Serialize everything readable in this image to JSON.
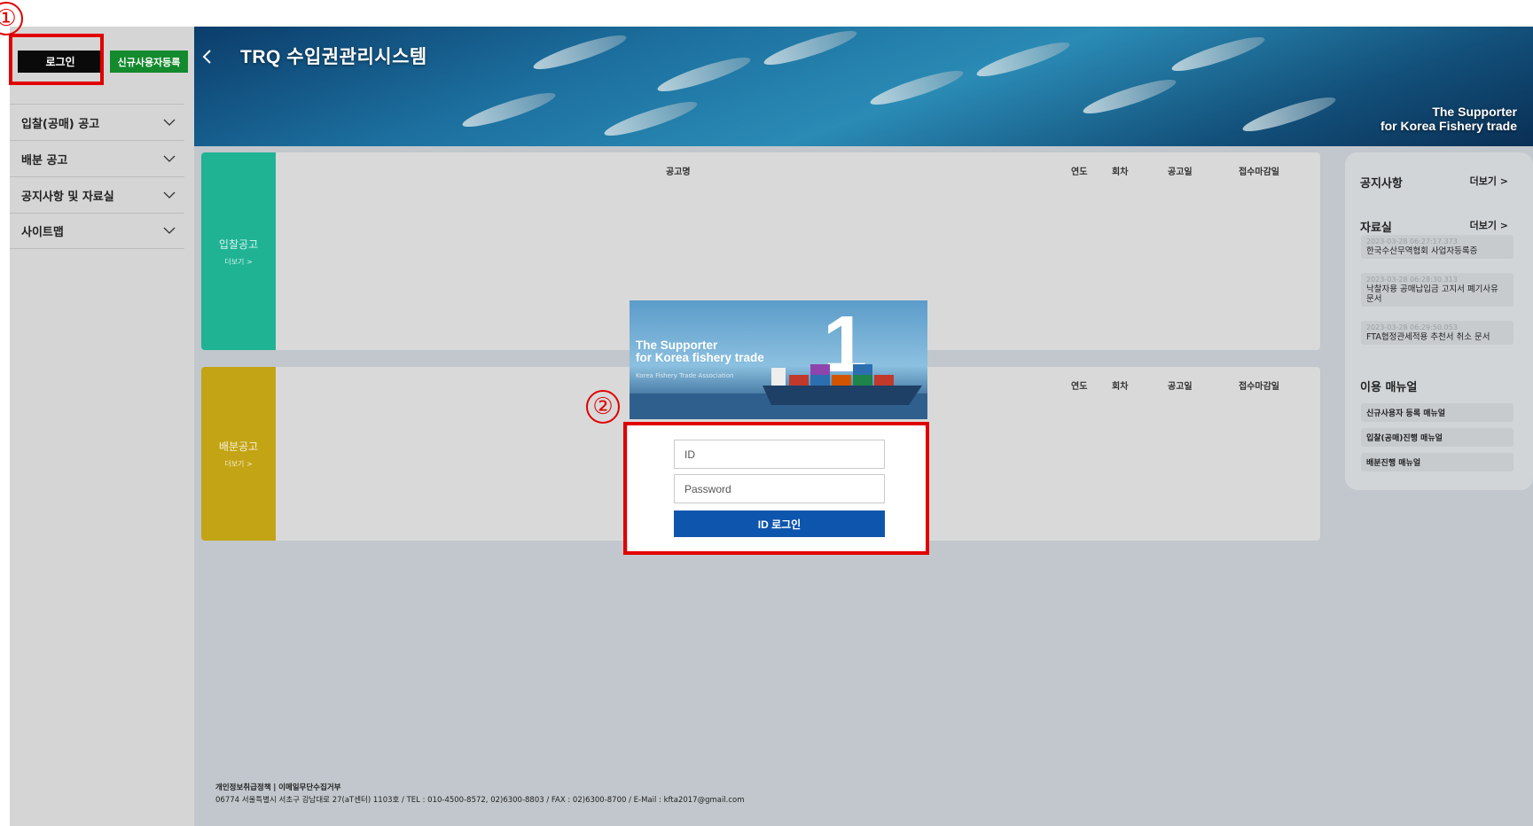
{
  "sidebar": {
    "login_label": "로그인",
    "register_label": "신규사용자등록",
    "nav": [
      {
        "label": "입찰(공매) 공고"
      },
      {
        "label": "배분 공고"
      },
      {
        "label": "공지사항 및 자료실"
      },
      {
        "label": "사이트맵"
      }
    ]
  },
  "header": {
    "title": "TRQ 수입권관리시스템",
    "tagline_1": "The Supporter",
    "tagline_2": "for Korea Fishery trade"
  },
  "bid_panel": {
    "side_title": "입찰공고",
    "side_more": "더보기 >",
    "columns": [
      "공고명",
      "연도",
      "회차",
      "공고일",
      "접수마감일"
    ]
  },
  "dist_panel": {
    "side_title": "배분공고",
    "side_more": "더보기 >",
    "columns": [
      "연도",
      "회차",
      "공고일",
      "접수마감일"
    ]
  },
  "info": {
    "notice_title": "공지사항",
    "notice_more": "더보기 >",
    "archive_title": "자료실",
    "archive_more": "더보기 >",
    "archive_items": [
      {
        "date": "2023-03-28 06:27:17.373",
        "title": "한국수산무역협회 사업자등록증"
      },
      {
        "date": "2023-03-28 06:28:30.313",
        "title": "낙찰자용 공매납입금 고지서 폐기사유 문서"
      },
      {
        "date": "2023-03-28 06:29:50.053",
        "title": "FTA협정관세적용 추천서 취소 문서"
      }
    ],
    "manual_title": "이용 매뉴얼",
    "manuals": [
      "신규사용자 등록 매뉴얼",
      "입찰(공매)진행 매뉴얼",
      "배분진행 매뉴얼"
    ]
  },
  "popup": {
    "image_title_1": "The Supporter",
    "image_title_2": "for Korea fishery trade",
    "image_subtitle": "Korea Fishery Trade Association",
    "image_big_number": "1",
    "id_placeholder": "ID",
    "password_placeholder": "Password",
    "login_button": "ID 로그인"
  },
  "footer": {
    "privacy": "개인정보취급정책",
    "separator": "|",
    "email_refusal": "이메일무단수집거부",
    "address": "06774 서울특별시 서초구 강남대로 27(aT센터) 1103호 / TEL : 010-4500-8572, 02)6300-8803 / FAX : 02)6300-8700 / E-Mail : kfta2017@gmail.com"
  },
  "annotations": {
    "marker_1": "①",
    "marker_2": "②",
    "color": "#e10000"
  },
  "colors": {
    "bid_accent": "#1fb394",
    "dist_accent": "#c3a414",
    "login_button": "#0e55ad",
    "register_button": "#138a2d"
  }
}
